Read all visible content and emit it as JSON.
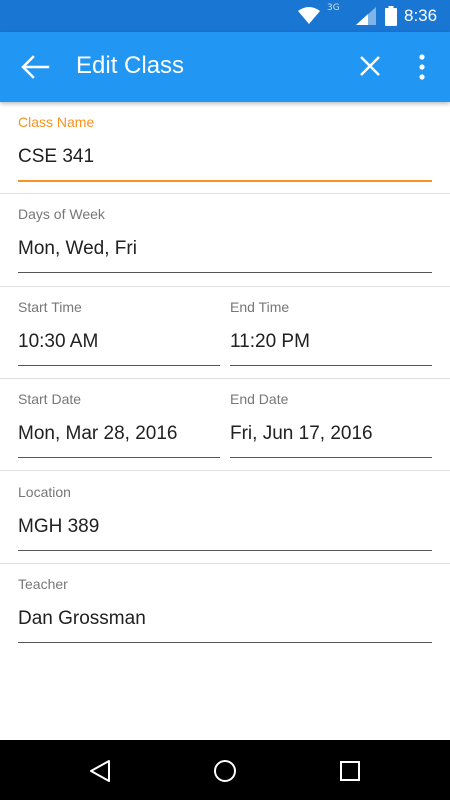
{
  "status_bar": {
    "network_label": "3G",
    "clock": "8:36",
    "icons": [
      "wifi-icon",
      "signal-icon",
      "battery-icon"
    ]
  },
  "app_bar": {
    "title": "Edit Class",
    "back_icon": "arrow-back-icon",
    "close_icon": "close-icon",
    "menu_icon": "more-vert-icon"
  },
  "form": {
    "class_name": {
      "label": "Class Name",
      "value": "CSE 341"
    },
    "days_of_week": {
      "label": "Days of Week",
      "value": "Mon, Wed, Fri"
    },
    "start_time": {
      "label": "Start Time",
      "value": "10:30 AM"
    },
    "end_time": {
      "label": "End Time",
      "value": "11:20 PM"
    },
    "start_date": {
      "label": "Start Date",
      "value": "Mon, Mar 28, 2016"
    },
    "end_date": {
      "label": "End Date",
      "value": "Fri, Jun 17, 2016"
    },
    "location": {
      "label": "Location",
      "value": "MGH 389"
    },
    "teacher": {
      "label": "Teacher",
      "value": "Dan Grossman"
    }
  },
  "nav_bar": {
    "icons": [
      "nav-back-icon",
      "nav-home-icon",
      "nav-recents-icon"
    ]
  },
  "colors": {
    "status_bar": "#1976D2",
    "app_bar": "#2196F3",
    "accent": "#F7931E"
  }
}
